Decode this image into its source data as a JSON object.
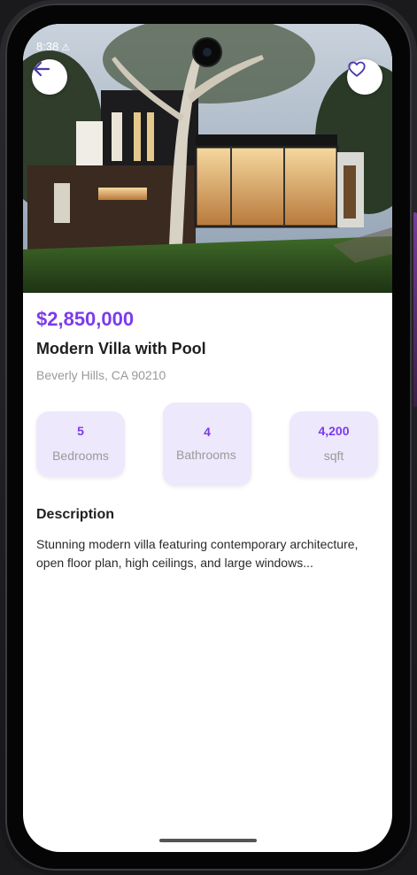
{
  "status_bar": {
    "time": "8:38",
    "warning_symbol": "⚠"
  },
  "listing": {
    "price": "$2,850,000",
    "title": "Modern Villa with Pool",
    "address": "Beverly Hills, CA 90210"
  },
  "stats": {
    "bedrooms": {
      "value": "5",
      "label": "Bedrooms"
    },
    "bathrooms": {
      "value": "4",
      "label": "Bathrooms"
    },
    "area": {
      "value": "4,200",
      "label": "sqft"
    }
  },
  "description": {
    "heading": "Description",
    "text": "Stunning modern villa featuring contemporary architecture, open floor plan, high ceilings, and large windows..."
  },
  "icons": {
    "back": "arrow-left-icon",
    "favorite": "heart-outline-icon"
  },
  "colors": {
    "accent": "#7c3aed",
    "stat_background": "#ede8fb",
    "muted_text": "#9a9a9a"
  }
}
